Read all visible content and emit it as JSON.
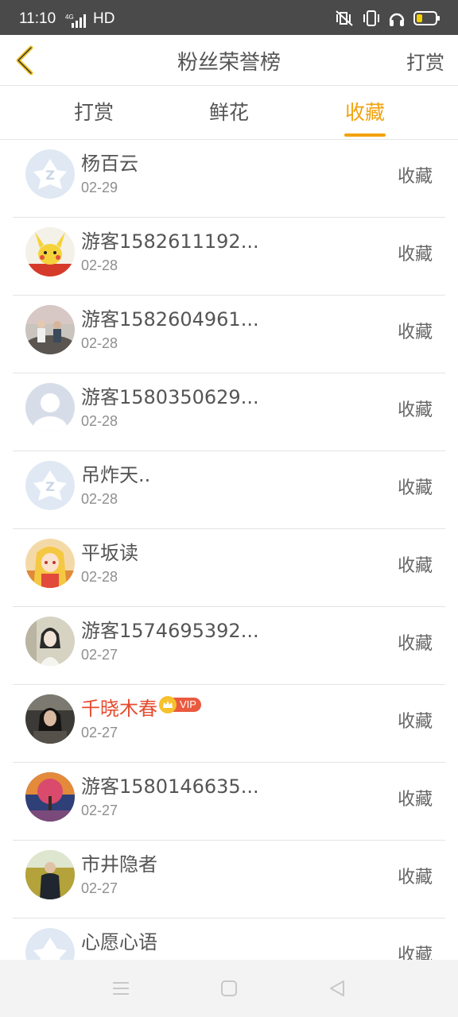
{
  "status_bar": {
    "time": "11:10",
    "network": "4G",
    "hd": "HD",
    "battery_color": "#f5d000"
  },
  "header": {
    "title": "粉丝荣誉榜",
    "action": "打赏",
    "back_icon": "chevron-left-icon"
  },
  "tabs": [
    {
      "label": "打赏",
      "active": false
    },
    {
      "label": "鲜花",
      "active": false
    },
    {
      "label": "收藏",
      "active": true
    }
  ],
  "accent_color": "#f2a20d",
  "fans": [
    {
      "name": "杨百云",
      "date": "02-29",
      "action": "收藏",
      "avatar": "default-qq-avatar"
    },
    {
      "name": "游客1582611192...",
      "date": "02-28",
      "action": "收藏",
      "avatar": "pikachu-avatar"
    },
    {
      "name": "游客1582604961...",
      "date": "02-28",
      "action": "收藏",
      "avatar": "photo-avatar"
    },
    {
      "name": "游客1580350629...",
      "date": "02-28",
      "action": "收藏",
      "avatar": "silhouette-avatar"
    },
    {
      "name": "吊炸天..",
      "date": "02-28",
      "action": "收藏",
      "avatar": "default-qq-avatar"
    },
    {
      "name": "平坂读",
      "date": "02-28",
      "action": "收藏",
      "avatar": "anime-avatar"
    },
    {
      "name": "游客1574695392...",
      "date": "02-27",
      "action": "收藏",
      "avatar": "photo-avatar"
    },
    {
      "name": "千晓木春",
      "date": "02-27",
      "action": "收藏",
      "avatar": "photo-avatar",
      "vip": "VIP"
    },
    {
      "name": "游客1580146635...",
      "date": "02-27",
      "action": "收藏",
      "avatar": "painting-avatar"
    },
    {
      "name": "市井隐者",
      "date": "02-27",
      "action": "收藏",
      "avatar": "photo-avatar"
    },
    {
      "name": "心愿心语",
      "date": "",
      "action": "收藏",
      "avatar": "default-qq-avatar"
    }
  ],
  "nav_bar": {
    "icons": [
      "menu-icon",
      "home-icon",
      "back-triangle-icon"
    ]
  }
}
